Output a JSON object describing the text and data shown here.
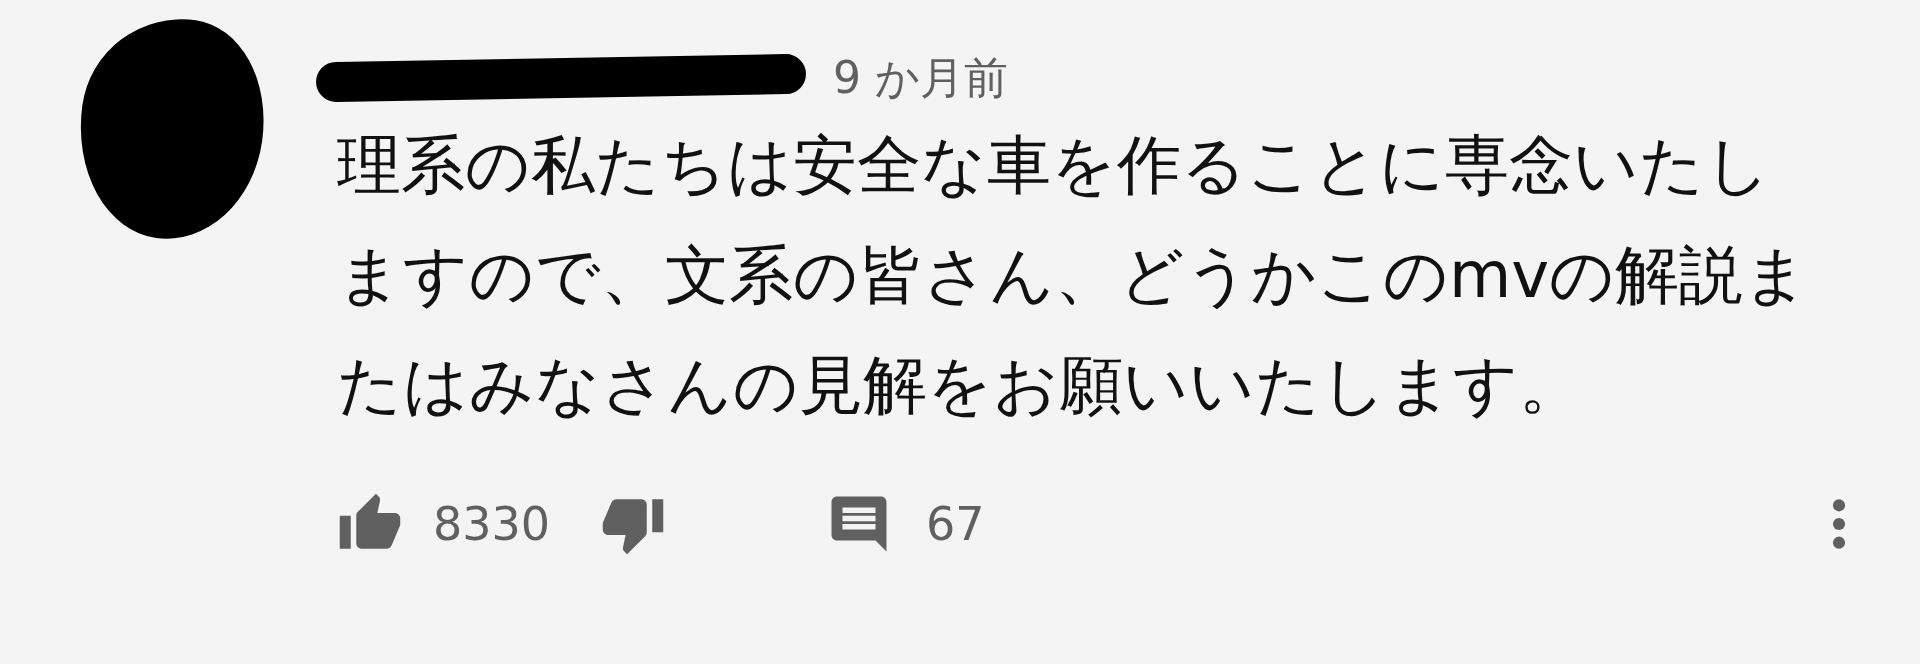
{
  "comment": {
    "time": "9 か月前",
    "text": "理系の私たちは安全な車を作ることに専念いたしますので、文系の皆さん、どうかこのmvの解説またはみなさんの見解をお願いいたします。",
    "likes": "8330",
    "replies": "67"
  }
}
